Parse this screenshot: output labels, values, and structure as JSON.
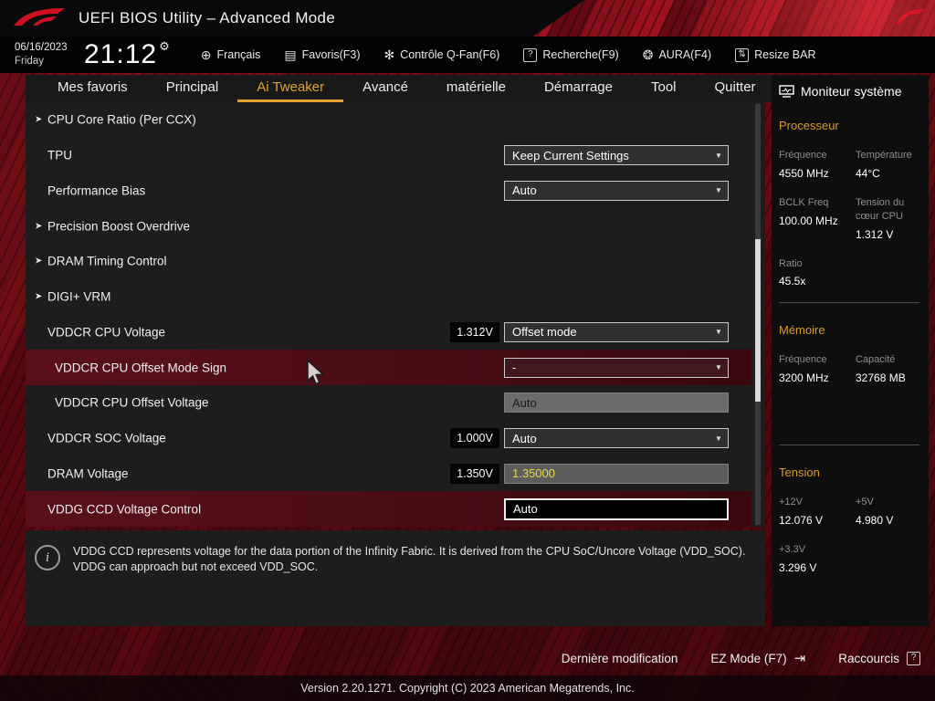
{
  "titlebar": {
    "title": "UEFI BIOS Utility – Advanced Mode"
  },
  "clockbar": {
    "date": "06/16/2023",
    "day": "Friday",
    "time": "21:12",
    "menu": [
      {
        "label": "Français"
      },
      {
        "label": "Favoris(F3)"
      },
      {
        "label": "Contrôle Q-Fan(F6)"
      },
      {
        "label": "Recherche(F9)"
      },
      {
        "label": "AURA(F4)"
      },
      {
        "label": "Resize BAR"
      }
    ]
  },
  "nav": {
    "tabs": [
      {
        "label": "Mes favoris",
        "active": false
      },
      {
        "label": "Principal",
        "active": false
      },
      {
        "label": "Ai Tweaker",
        "active": true
      },
      {
        "label": "Avancé",
        "active": false
      },
      {
        "label": "matérielle",
        "active": false
      },
      {
        "label": "Démarrage",
        "active": false
      },
      {
        "label": "Tool",
        "active": false
      },
      {
        "label": "Quitter",
        "active": false
      }
    ]
  },
  "settings": {
    "rows": [
      {
        "type": "submenu",
        "label": "CPU Core Ratio (Per CCX)"
      },
      {
        "type": "dropdown",
        "label": "TPU",
        "value": "Keep Current Settings"
      },
      {
        "type": "dropdown",
        "label": "Performance Bias",
        "value": "Auto"
      },
      {
        "type": "submenu",
        "label": "Precision Boost Overdrive"
      },
      {
        "type": "submenu",
        "label": "DRAM Timing Control"
      },
      {
        "type": "submenu",
        "label": "DIGI+ VRM"
      },
      {
        "type": "dropdown",
        "label": "VDDCR CPU Voltage",
        "current": "1.312V",
        "value": "Offset mode"
      },
      {
        "type": "dropdown",
        "label": "VDDCR CPU Offset Mode Sign",
        "value": "-",
        "highlighted": true
      },
      {
        "type": "input",
        "label": "VDDCR CPU Offset Voltage",
        "value": "Auto",
        "disabled": true
      },
      {
        "type": "dropdown",
        "label": "VDDCR SOC Voltage",
        "current": "1.000V",
        "value": "Auto"
      },
      {
        "type": "input",
        "label": "DRAM Voltage",
        "current": "1.350V",
        "value": "1.35000",
        "modified": true
      },
      {
        "type": "input",
        "label": "VDDG CCD Voltage Control",
        "value": "Auto",
        "highlighted": true,
        "focused": true
      }
    ]
  },
  "help": {
    "text": "VDDG CCD represents voltage for the data portion of the Infinity Fabric. It is derived from the CPU SoC/Uncore Voltage (VDD_SOC). VDDG can approach but not exceed VDD_SOC."
  },
  "monitor": {
    "title": "Moniteur système",
    "processor": {
      "heading": "Processeur",
      "freq_label": "Fréquence",
      "freq_value": "4550 MHz",
      "temp_label": "Température",
      "temp_value": "44°C",
      "bclk_label": "BCLK Freq",
      "bclk_value": "100.00 MHz",
      "core_v_label": "Tension du cœur CPU",
      "core_v_value": "1.312 V",
      "ratio_label": "Ratio",
      "ratio_value": "45.5x"
    },
    "memory": {
      "heading": "Mémoire",
      "freq_label": "Fréquence",
      "freq_value": "3200 MHz",
      "cap_label": "Capacité",
      "cap_value": "32768 MB"
    },
    "voltage": {
      "heading": "Tension",
      "v12_label": "+12V",
      "v12_value": "12.076 V",
      "v5_label": "+5V",
      "v5_value": "4.980 V",
      "v33_label": "+3.3V",
      "v33_value": "3.296 V"
    }
  },
  "footer": {
    "last_modified": "Dernière modification",
    "ez_mode": "EZ Mode (F7)",
    "shortcuts": "Raccourcis",
    "version": "Version 2.20.1271. Copyright (C) 2023 American Megatrends, Inc."
  },
  "icons": {
    "chevron_down": "▼",
    "link_arrow": "➤",
    "globe": "⊕",
    "favorites": "▤",
    "fan": "✻",
    "question": "?",
    "aura": "❂",
    "resize": "⇅",
    "gear": "⚙",
    "info": "i",
    "exit": "⇥"
  },
  "colors": {
    "accent_orange": "#e3a02f",
    "rog_red": "#c00f22",
    "modified_yellow": "#e3da45"
  }
}
